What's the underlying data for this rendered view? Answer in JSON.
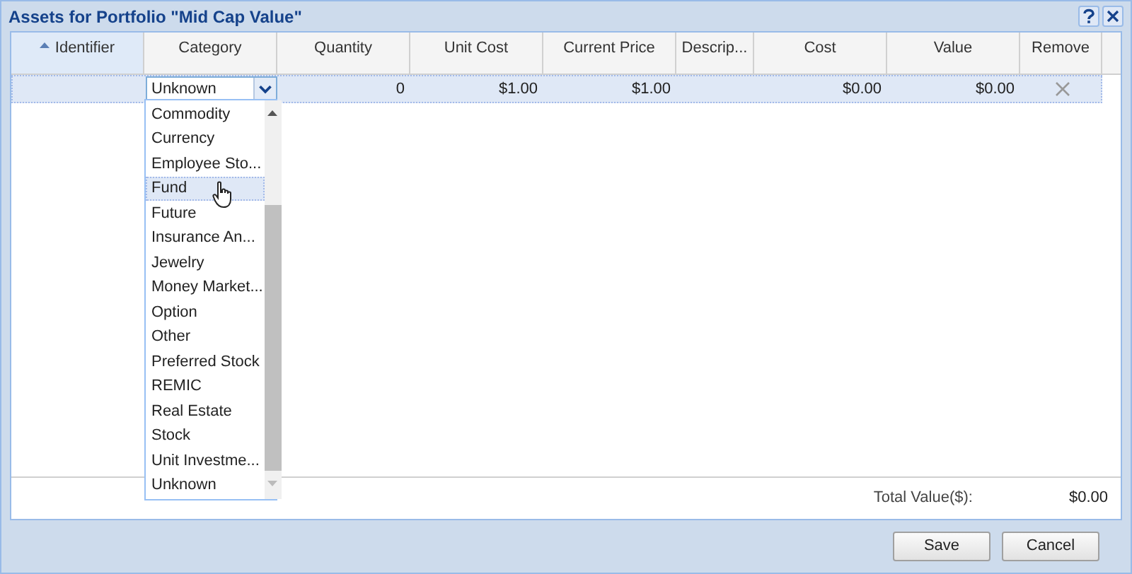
{
  "window": {
    "title": "Assets for Portfolio \"Mid Cap Value\""
  },
  "columns": [
    {
      "label": "Identifier",
      "sorted": true
    },
    {
      "label": "Category",
      "sorted": false
    },
    {
      "label": "Quantity",
      "sorted": false
    },
    {
      "label": "Unit Cost",
      "sorted": false
    },
    {
      "label": "Current Price",
      "sorted": false
    },
    {
      "label": "Descrip...",
      "sorted": false
    },
    {
      "label": "Cost",
      "sorted": false
    },
    {
      "label": "Value",
      "sorted": false
    },
    {
      "label": "Remove",
      "sorted": false
    }
  ],
  "rows": [
    {
      "selected": true,
      "category": "Unknown",
      "quantity": "0",
      "unit_cost": "$1.00",
      "current_price": "$1.00",
      "cost": "$0.00",
      "value": "$0.00"
    }
  ],
  "dropdown": [
    {
      "label": "Commodity",
      "selected": false
    },
    {
      "label": "Currency",
      "selected": false
    },
    {
      "label": "Employee Sto...",
      "selected": false
    },
    {
      "label": "Fund",
      "selected": true
    },
    {
      "label": "Future",
      "selected": false
    },
    {
      "label": "Insurance An...",
      "selected": false
    },
    {
      "label": "Jewelry",
      "selected": false
    },
    {
      "label": "Money Market...",
      "selected": false
    },
    {
      "label": "Option",
      "selected": false
    },
    {
      "label": "Other",
      "selected": false
    },
    {
      "label": "Preferred Stock",
      "selected": false
    },
    {
      "label": "REMIC",
      "selected": false
    },
    {
      "label": "Real Estate",
      "selected": false
    },
    {
      "label": "Stock",
      "selected": false
    },
    {
      "label": "Unit Investme...",
      "selected": false
    },
    {
      "label": "Unknown",
      "selected": false
    }
  ],
  "total": {
    "label": "Total Value($):",
    "value": "$0.00"
  },
  "buttons": [
    "Save",
    "Cancel"
  ]
}
